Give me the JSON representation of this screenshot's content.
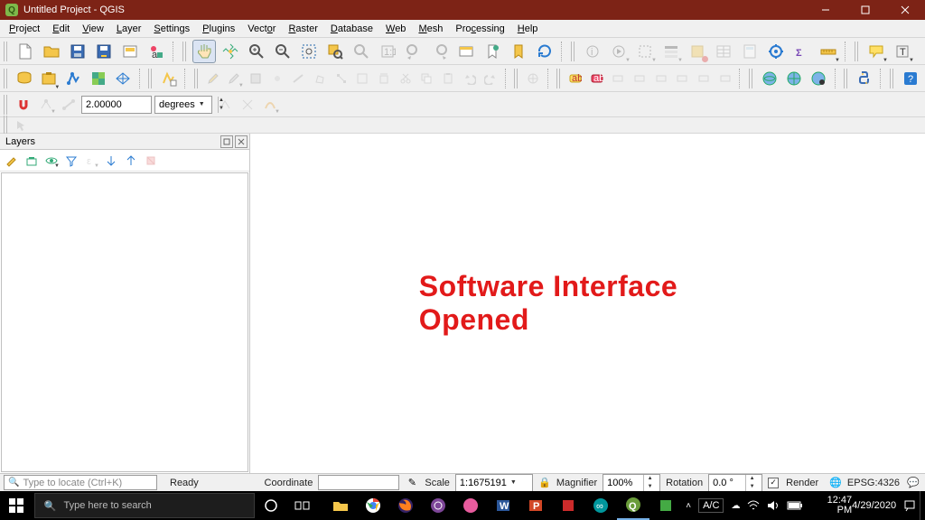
{
  "title": "Untitled Project - QGIS",
  "menus": [
    "Project",
    "Edit",
    "View",
    "Layer",
    "Settings",
    "Plugins",
    "Vector",
    "Raster",
    "Database",
    "Web",
    "Mesh",
    "Processing",
    "Help"
  ],
  "snapRow": {
    "value": "2.00000",
    "units": "degrees"
  },
  "layers": {
    "title": "Layers"
  },
  "overlay": "Software Interface Opened",
  "status": {
    "searchPlaceholder": "Type to locate (Ctrl+K)",
    "ready": "Ready",
    "coordLabel": "Coordinate",
    "coordValue": "",
    "scaleLabel": "Scale",
    "scaleValue": "1:1675191",
    "magLabel": "Magnifier",
    "magValue": "100%",
    "rotLabel": "Rotation",
    "rotValue": "0.0 °",
    "renderLabel": "Render",
    "crs": "EPSG:4326"
  },
  "taskbar": {
    "searchPlaceholder": "Type here to search",
    "ac": "A/C",
    "time": "12:47 PM",
    "date": "4/29/2020"
  }
}
